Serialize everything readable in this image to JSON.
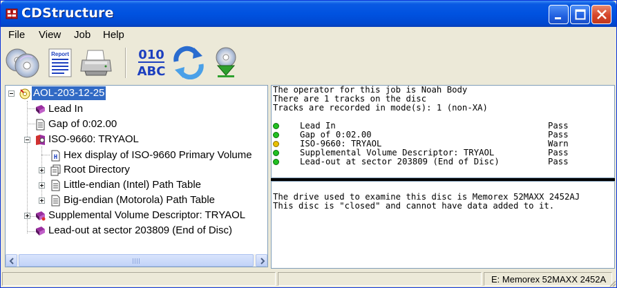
{
  "window": {
    "title": "CDStructure",
    "controls": [
      "minimize",
      "maximize",
      "close"
    ],
    "title_bar_color": "#0052e0"
  },
  "menu": {
    "items": [
      "File",
      "View",
      "Job",
      "Help"
    ]
  },
  "toolbar": {
    "buttons": [
      {
        "name": "open-disc",
        "icon": "cd-discs-icon"
      },
      {
        "name": "report",
        "icon": "report-icon",
        "label": "Report"
      },
      {
        "name": "print",
        "icon": "printer-icon"
      },
      {
        "name": "binary-text",
        "icon": "binary-abc-icon",
        "top_text": "010",
        "bottom_text": "ABC"
      },
      {
        "name": "refresh",
        "icon": "refresh-icon"
      },
      {
        "name": "eject",
        "icon": "disc-download-icon"
      }
    ]
  },
  "tree": {
    "items": [
      {
        "label": "AOL-203-12-25",
        "icon": "disc-root-icon",
        "selected": true,
        "expander": "minus"
      },
      {
        "label": "Lead In",
        "icon": "book-icon"
      },
      {
        "label": "Gap of 0:02.00",
        "icon": "document-icon"
      },
      {
        "label": "ISO-9660: TRYAOL",
        "icon": "iso-book-icon",
        "expander": "minus"
      },
      {
        "label": "Hex display of ISO-9660 Primary Volume",
        "icon": "hex-document-icon"
      },
      {
        "label": "Root Directory",
        "icon": "folder-documents-icon",
        "expander": "plus"
      },
      {
        "label": "Little-endian (Intel) Path Table",
        "icon": "document-icon",
        "expander": "plus"
      },
      {
        "label": "Big-endian (Motorola) Path Table",
        "icon": "document-icon",
        "expander": "plus"
      },
      {
        "label": "Supplemental Volume Descriptor: TRYAOL",
        "icon": "supplemental-book-icon",
        "expander": "plus"
      },
      {
        "label": "Lead-out at sector 203809 (End of Disc)",
        "icon": "book-icon"
      }
    ]
  },
  "info": {
    "lines": [
      "The operator for this job is Noah Body",
      "There are 1 tracks on the disc",
      "Tracks are recorded in mode(s): 1 (non-XA)"
    ],
    "results": [
      {
        "name": "Lead In",
        "status": "Pass",
        "color": "#22c022"
      },
      {
        "name": "Gap of 0:02.00",
        "status": "Pass",
        "color": "#22c022"
      },
      {
        "name": "ISO-9660: TRYAOL",
        "status": "Warn",
        "color": "#e8c000"
      },
      {
        "name": "Supplemental Volume Descriptor: TRYAOL",
        "status": "Pass",
        "color": "#22c022"
      },
      {
        "name": "Lead-out at sector 203809 (End of Disc)",
        "status": "Pass",
        "color": "#22c022"
      }
    ]
  },
  "drive": {
    "lines": [
      "The drive used to examine this disc is Memorex 52MAXX 2452AJ",
      "This disc is \"closed\" and cannot have data added to it."
    ]
  },
  "status_bar": {
    "panel1": "",
    "panel2": "",
    "panel3": "E: Memorex 52MAXX 2452A"
  }
}
